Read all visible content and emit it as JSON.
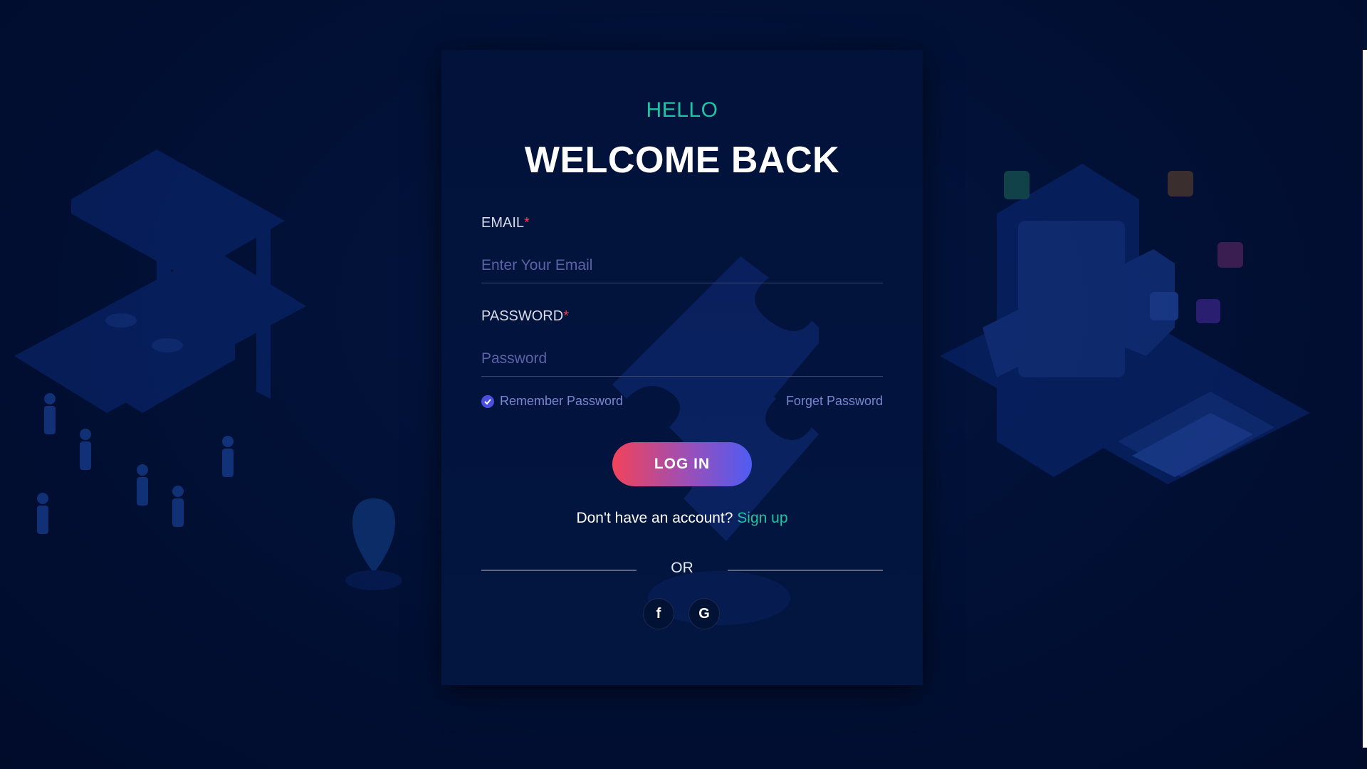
{
  "login": {
    "greeting": "HELLO",
    "title": "WELCOME BACK",
    "email_label": "EMAIL",
    "email_placeholder": "Enter Your Email",
    "password_label": "PASSWORD",
    "password_placeholder": "Password",
    "required_mark": "*",
    "remember_label": "Remember Password",
    "remember_checked": true,
    "forget_label": "Forget Password",
    "login_button": "LOG IN",
    "signup_prompt": "Don't have an account?",
    "signup_link": "Sign up",
    "divider_text": "OR"
  },
  "social": [
    {
      "icon": "facebook-icon",
      "glyph": "f"
    },
    {
      "icon": "google-icon",
      "glyph": "G"
    }
  ],
  "colors": {
    "background": "#010f33",
    "accent": "#20c4a4",
    "required": "#ff3b4e",
    "button_gradient_start": "#f2435a",
    "button_gradient_end": "#4f5cf3"
  }
}
